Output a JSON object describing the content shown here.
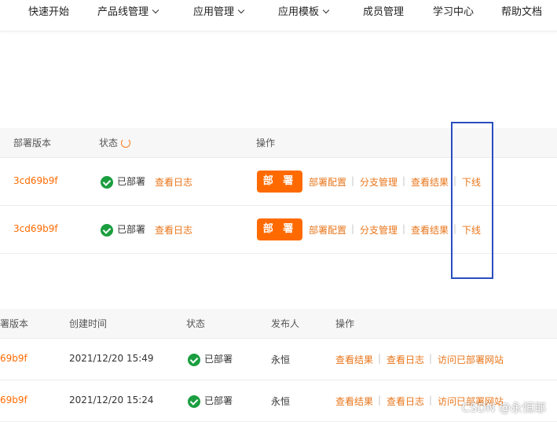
{
  "nav": {
    "items": [
      {
        "label": "快速开始",
        "dropdown": false
      },
      {
        "label": "产品线管理",
        "dropdown": true
      },
      {
        "label": "应用管理",
        "dropdown": true
      },
      {
        "label": "应用模板",
        "dropdown": true
      },
      {
        "label": "成员管理",
        "dropdown": false
      },
      {
        "label": "学习中心",
        "dropdown": false
      },
      {
        "label": "帮助文档",
        "dropdown": false
      }
    ]
  },
  "deploy_table": {
    "headers": {
      "version": "部署版本",
      "status": "状态",
      "actions": "操作"
    },
    "rows": [
      {
        "version": "3cd69b9f",
        "status": "已部署",
        "view_log": "查看日志",
        "deploy": "部 署",
        "config": "部署配置",
        "branch": "分支管理",
        "result": "查看结果",
        "offline": "下线"
      },
      {
        "version": "3cd69b9f",
        "status": "已部署",
        "view_log": "查看日志",
        "deploy": "部 署",
        "config": "部署配置",
        "branch": "分支管理",
        "result": "查看结果",
        "offline": "下线"
      }
    ]
  },
  "history_table": {
    "headers": {
      "version": "署版本",
      "created": "创建时间",
      "status": "状态",
      "publisher": "发布人",
      "actions": "操作"
    },
    "rows": [
      {
        "version": "69b9f",
        "created": "2021/12/20 15:49",
        "status": "已部署",
        "publisher": "永恒",
        "result": "查看结果",
        "log": "查看日志",
        "visit": "访问已部署网站"
      },
      {
        "version": "69b9f",
        "created": "2021/12/20 15:24",
        "status": "已部署",
        "publisher": "永恒",
        "result": "查看结果",
        "log": "查看日志",
        "visit": "访问已部署网站"
      }
    ]
  },
  "watermark": "CSDN @永恒耶",
  "colors": {
    "accent": "#ff6a00",
    "success": "#1a9e3f",
    "highlight_box": "#2a4dbf"
  }
}
